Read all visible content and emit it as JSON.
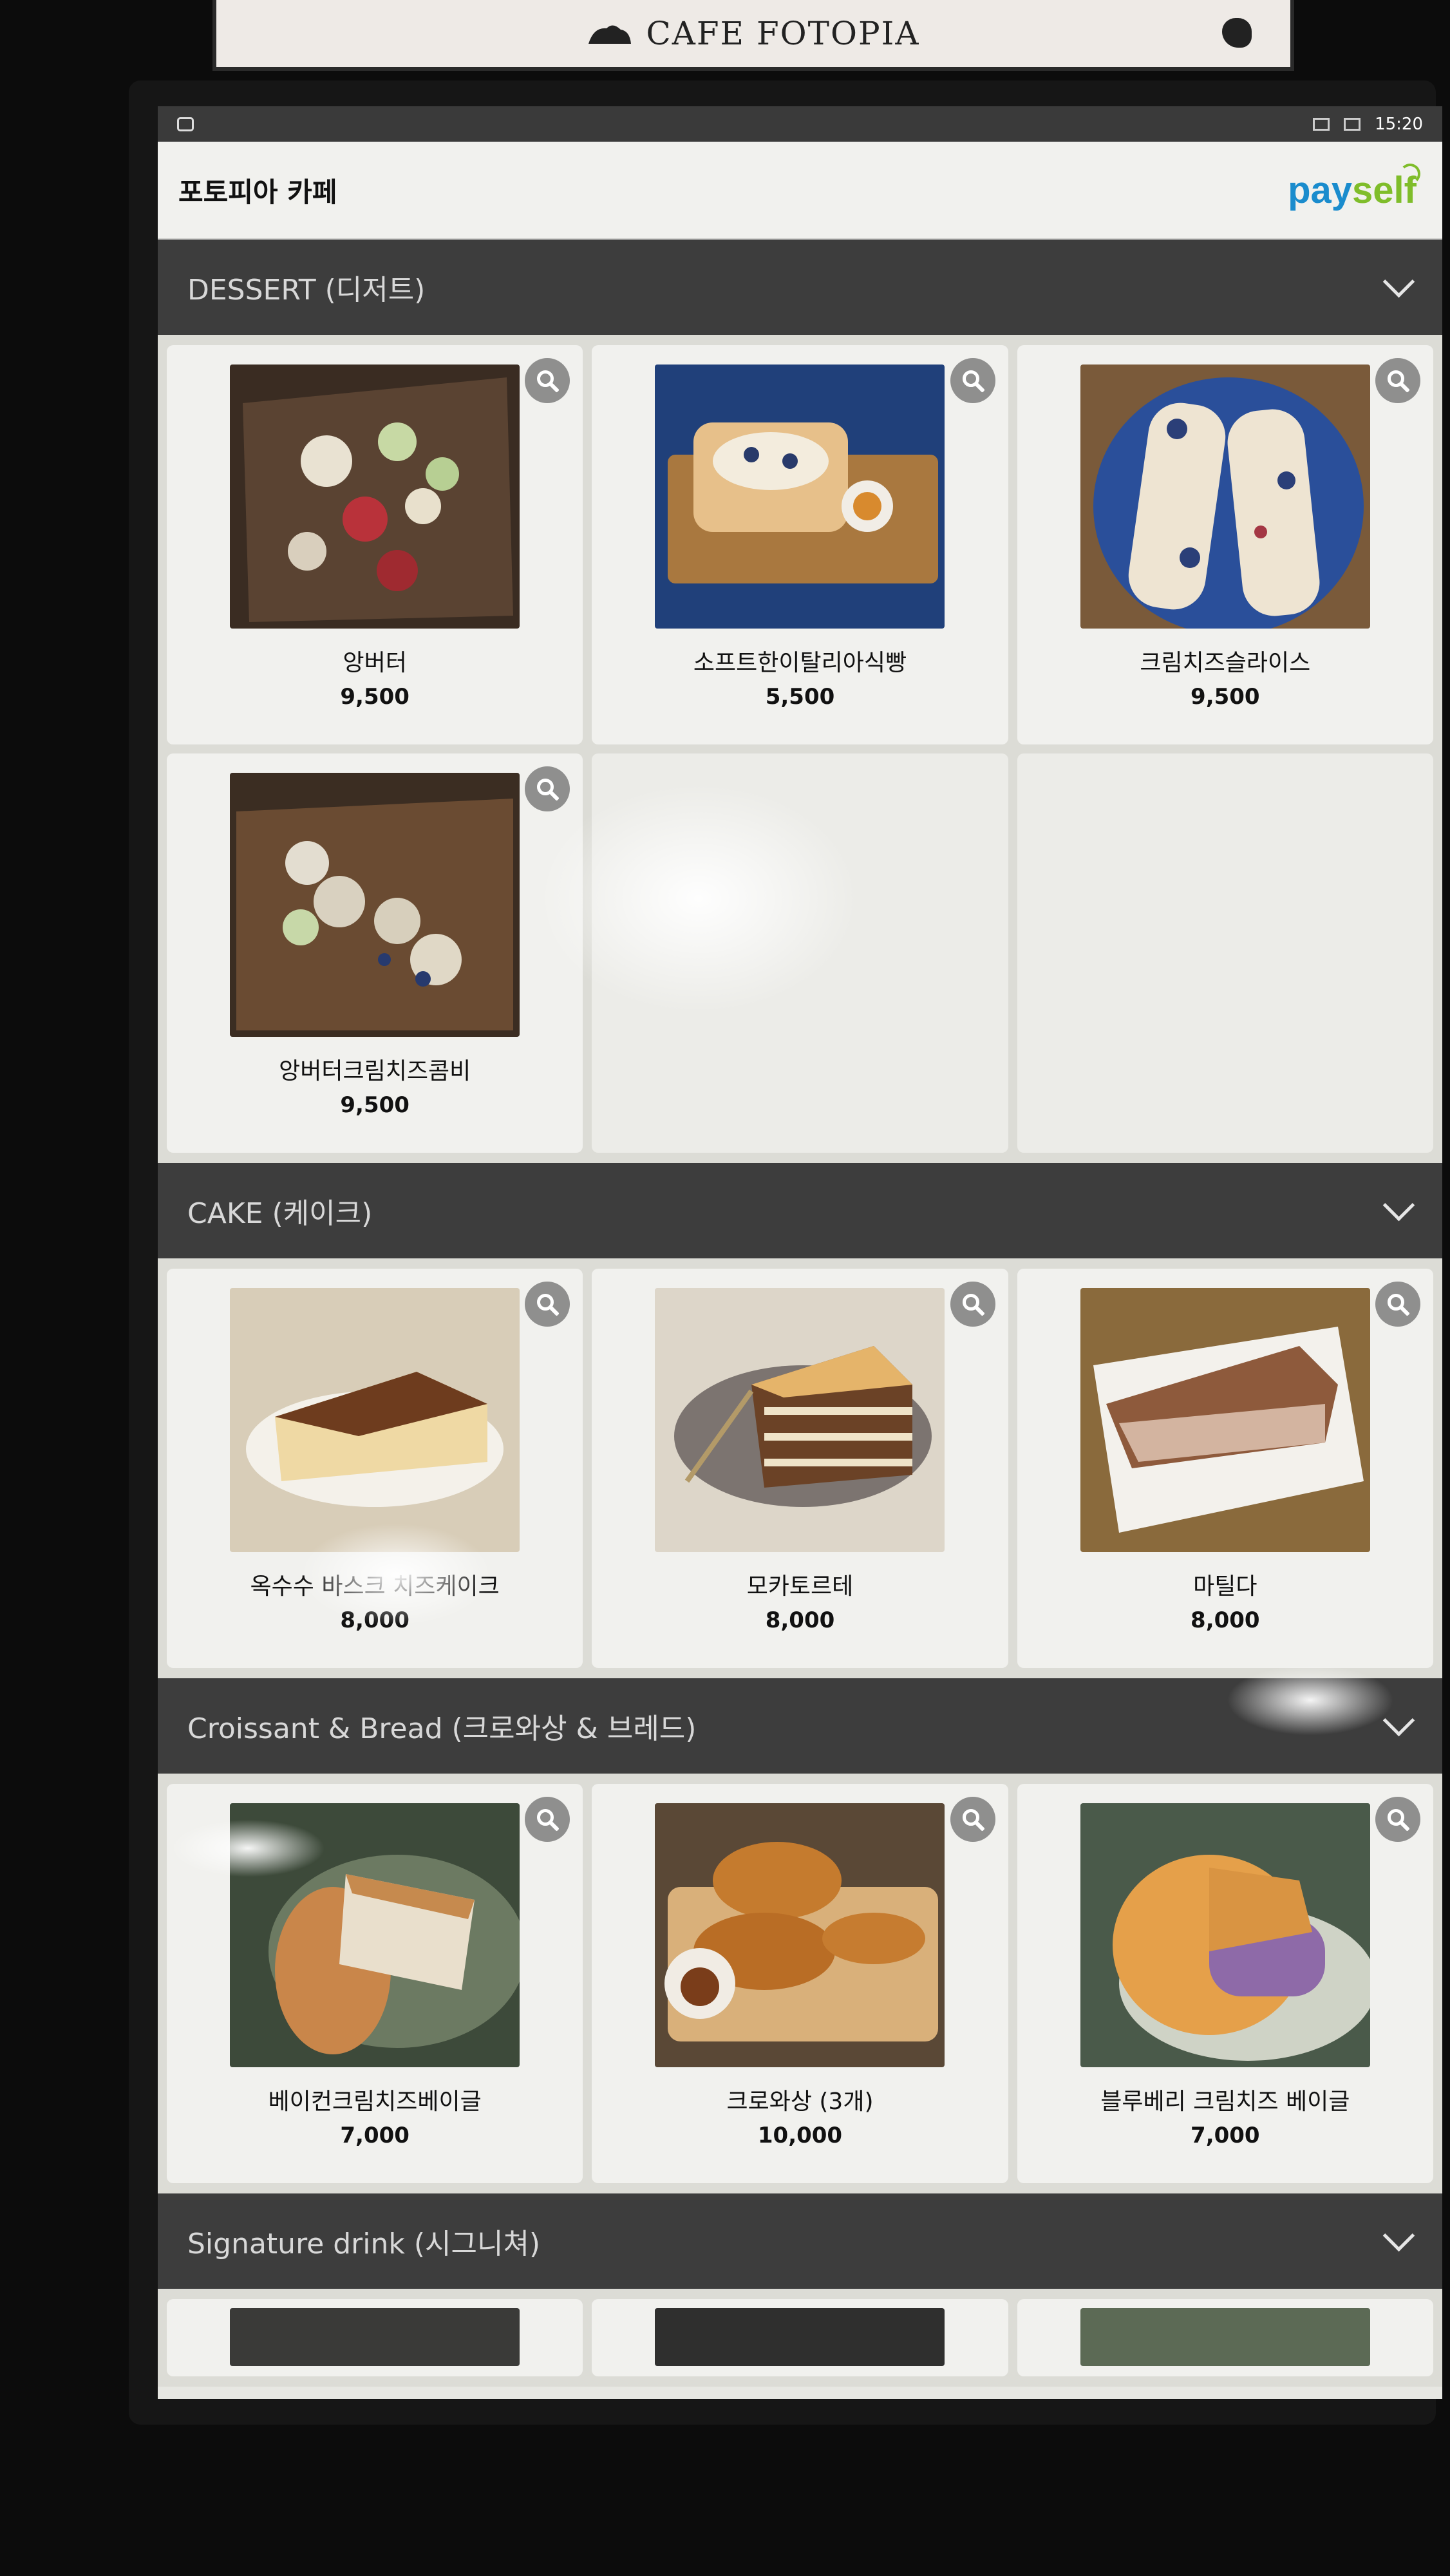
{
  "sign": {
    "text": "CAFE FOTOPIA"
  },
  "status_bar": {
    "time": "15:20"
  },
  "header": {
    "shop_name": "포토피아 카페",
    "logo": {
      "part1": "pay",
      "part2": "self"
    }
  },
  "sections": [
    {
      "title": "DESSERT (디저트)",
      "items": [
        {
          "name": "앙버터",
          "price": "9,500"
        },
        {
          "name": "소프트한이탈리아식빵",
          "price": "5,500"
        },
        {
          "name": "크림치즈슬라이스",
          "price": "9,500"
        },
        {
          "name": "앙버터크림치즈콤비",
          "price": "9,500"
        }
      ]
    },
    {
      "title": "CAKE (케이크)",
      "items": [
        {
          "name": "옥수수 바스크 치즈케이크",
          "price": "8,000"
        },
        {
          "name": "모카토르테",
          "price": "8,000"
        },
        {
          "name": "마틸다",
          "price": "8,000"
        }
      ]
    },
    {
      "title": "Croissant & Bread (크로와상 & 브레드)",
      "items": [
        {
          "name": "베이컨크림치즈베이글",
          "price": "7,000"
        },
        {
          "name": "크로와상 (3개)",
          "price": "10,000"
        },
        {
          "name": "블루베리 크림치즈 베이글",
          "price": "7,000"
        }
      ]
    },
    {
      "title": "Signature drink (시그니쳐)"
    }
  ],
  "colors": {
    "section_header_bg": "#3d3d3d",
    "pay_blue": "#1a8ccd",
    "self_green": "#7fbd2a"
  }
}
